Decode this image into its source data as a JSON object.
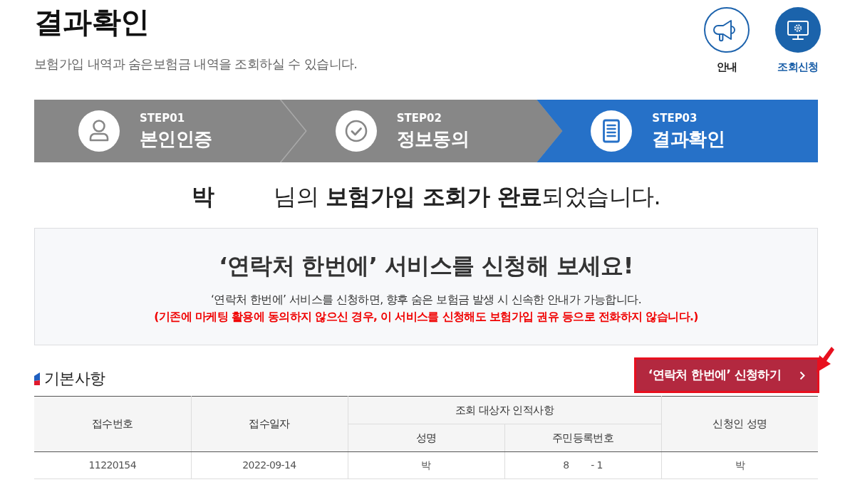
{
  "page": {
    "title": "결과확인",
    "subtitle": "보험가입 내역과 숨은보험금 내역을 조회하실 수 있습니다."
  },
  "nav": [
    {
      "label": "안내",
      "selected": false
    },
    {
      "label": "조회신청",
      "selected": true
    }
  ],
  "steps": [
    {
      "number": "STEP01",
      "label": "본인인증",
      "selected": false
    },
    {
      "number": "STEP02",
      "label": "정보동의",
      "selected": false
    },
    {
      "number": "STEP03",
      "label": "결과확인",
      "selected": true
    }
  ],
  "result": {
    "name": "박",
    "message": "님의 **보험가입 조회가 완료**되었습니다."
  },
  "promo": {
    "title": "‘연락처 한번에’ 서비스를 신청해 보세요!",
    "description": "‘연락처 한번에’ 서비스를 신청하면, 향후 숨은 보험금 발생 시 신속한 안내가 가능합니다.",
    "warning": "(기존에 마케팅 활용에 동의하지 않으신 경우, 이 서비스를 신청해도 보험가입 권유 등으로 전화하지 않습니다.)",
    "button": "‘연락처 한번에’ 신청하기"
  },
  "basic_info": {
    "title": "기본사항",
    "header_rows": [
      [
        {
          "label": "접수번호",
          "rowspan": 2
        },
        {
          "label": "접수일자",
          "rowspan": 2
        },
        {
          "label": "조회 대상자 인적사항",
          "colspan": 2
        },
        {
          "label": "신청인 성명",
          "rowspan": 2
        }
      ],
      [
        {
          "label": "성명"
        },
        {
          "label": "주민등록번호"
        }
      ]
    ],
    "rows": [
      [
        "11220154",
        "2022-09-14",
        "박",
        "8        - 1",
        "박"
      ]
    ]
  }
}
